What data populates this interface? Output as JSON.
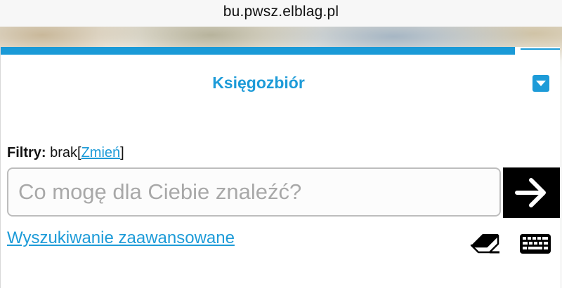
{
  "browser": {
    "url": "bu.pwsz.elblag.pl"
  },
  "progress": {
    "value": 0.92,
    "color": "#1a9ad7"
  },
  "header": {
    "title": "Księgozbiór",
    "dropdown_icon": "chevron-down-icon"
  },
  "filters": {
    "label": "Filtry:",
    "value": "brak",
    "bracket_open": "[",
    "change_link": "Zmień",
    "bracket_close": "]"
  },
  "search": {
    "placeholder": "Co mogę dla Ciebie znaleźć?",
    "value": "",
    "submit_icon": "arrow-right-icon"
  },
  "advanced_search": {
    "label": "Wyszukiwanie zaawansowane"
  },
  "tools": {
    "clear_icon": "eraser-icon",
    "keyboard_icon": "keyboard-icon"
  },
  "colors": {
    "accent": "#1d9bd8",
    "search_button": "#000000"
  }
}
